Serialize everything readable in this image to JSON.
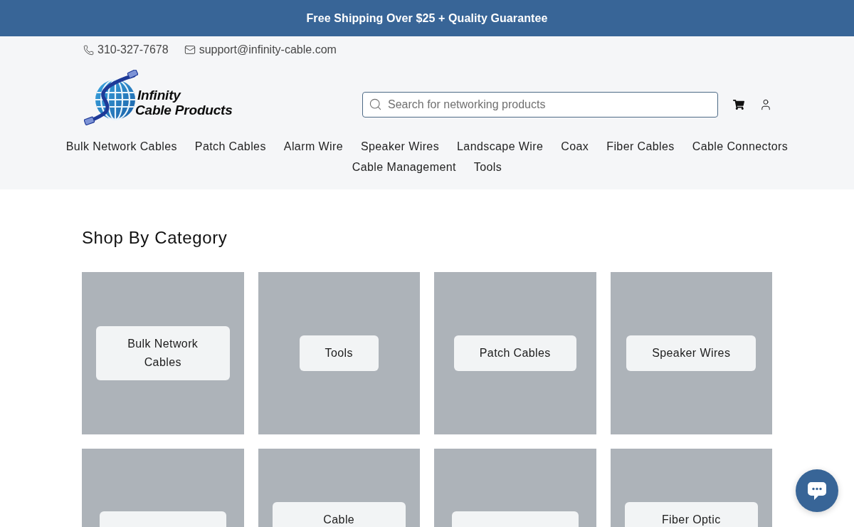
{
  "announcement_bar": {
    "text": "Free Shipping Over $25 + Quality Guarantee"
  },
  "contact": {
    "phone": "310-327-7678",
    "email": "support@infinity-cable.com"
  },
  "logo": {
    "lines": [
      "Infinity",
      "Cable Products"
    ]
  },
  "search": {
    "placeholder": "Search for networking products"
  },
  "nav": {
    "items": [
      "Bulk Network Cables",
      "Patch Cables",
      "Alarm Wire",
      "Speaker Wires",
      "Landscape Wire",
      "Coax",
      "Fiber Cables",
      "Cable Connectors",
      "Cable Management",
      "Tools"
    ]
  },
  "section": {
    "title": "Shop By Category"
  },
  "categories": [
    {
      "kind": "label",
      "label": "Bulk Network Cables"
    },
    {
      "kind": "label",
      "label": "Tools"
    },
    {
      "kind": "label",
      "label": "Patch Cables"
    },
    {
      "kind": "label",
      "label": "Speaker Wires"
    },
    {
      "kind": "blank_label"
    },
    {
      "kind": "cut_label",
      "label": "Cable"
    },
    {
      "kind": "blank_label"
    },
    {
      "kind": "cut_label",
      "label": "Fiber Optic"
    }
  ]
}
